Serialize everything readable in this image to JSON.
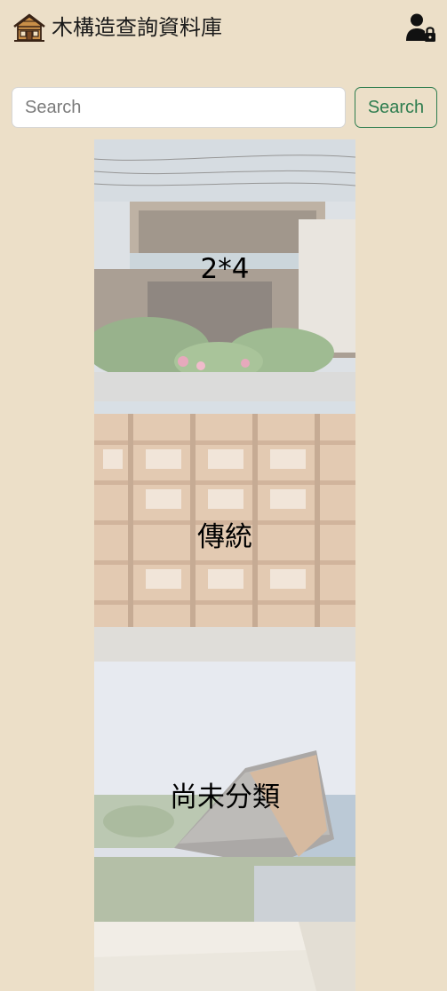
{
  "header": {
    "logo_icon": "wooden-house-icon",
    "title": "木構造查詢資料庫",
    "user_icon": "user-lock-icon"
  },
  "search": {
    "placeholder": "Search",
    "value": "",
    "button_label": "Search"
  },
  "categories": [
    {
      "label": "2*4"
    },
    {
      "label": "傳統"
    },
    {
      "label": "尚未分類"
    },
    {
      "label": ""
    }
  ],
  "colors": {
    "background": "#ecdfc8",
    "accent": "#2e7d4f"
  }
}
